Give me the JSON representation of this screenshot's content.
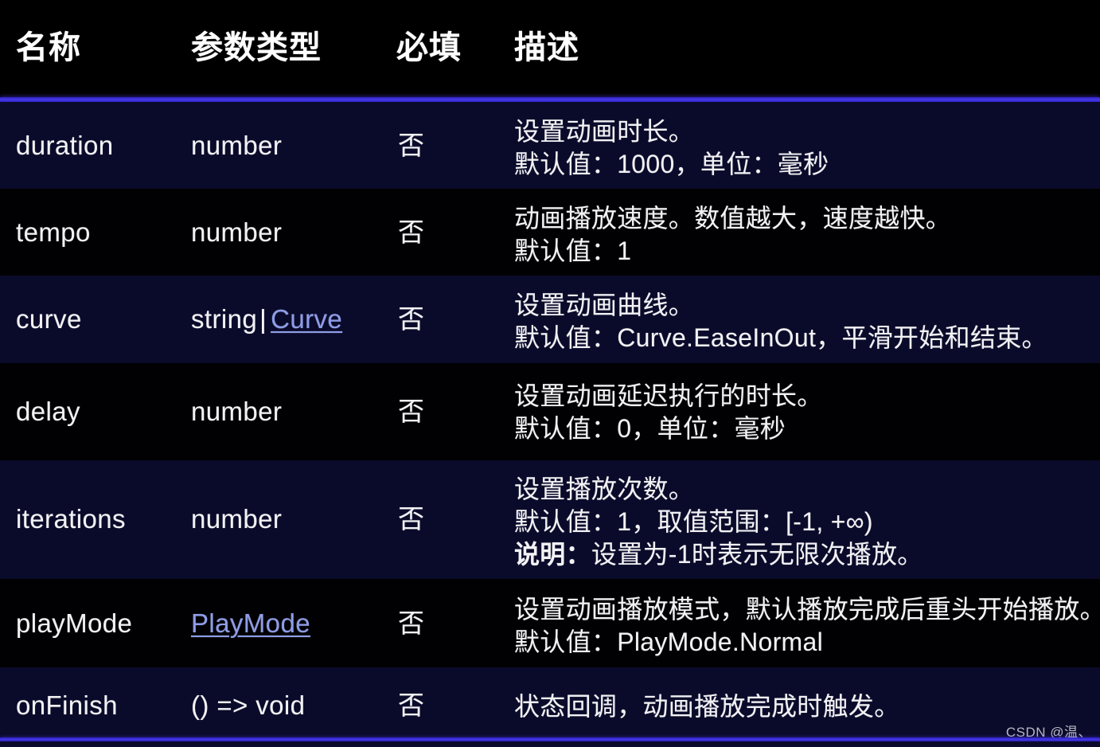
{
  "table": {
    "columns": [
      {
        "key": "name",
        "label": "名称"
      },
      {
        "key": "type",
        "label": "参数类型"
      },
      {
        "key": "required",
        "label": "必填"
      },
      {
        "key": "description",
        "label": "描述"
      }
    ],
    "rows": [
      {
        "name": "duration",
        "type_text": "number",
        "type_link": "",
        "required": "否",
        "desc_lines": [
          "设置动画时长。",
          "默认值：1000，单位：毫秒"
        ]
      },
      {
        "name": "tempo",
        "type_text": "number",
        "type_link": "",
        "required": "否",
        "desc_lines": [
          "动画播放速度。数值越大，速度越快。",
          "默认值：1"
        ]
      },
      {
        "name": "curve",
        "type_text": "string",
        "type_link": "Curve",
        "required": "否",
        "desc_lines": [
          "设置动画曲线。",
          "默认值：Curve.EaseInOut，平滑开始和结束。"
        ]
      },
      {
        "name": "delay",
        "type_text": "number",
        "type_link": "",
        "required": "否",
        "desc_lines": [
          "设置动画延迟执行的时长。",
          "默认值：0，单位：毫秒"
        ]
      },
      {
        "name": "iterations",
        "type_text": "number",
        "type_link": "",
        "required": "否",
        "desc_lines": [
          "设置播放次数。",
          "默认值：1，取值范围：[-1, +∞)",
          "说明：设置为-1时表示无限次播放。"
        ],
        "desc_bold_prefix_line": 2,
        "desc_bold_prefix": "说明："
      },
      {
        "name": "playMode",
        "type_text": "",
        "type_link": "PlayMode",
        "required": "否",
        "desc_lines": [
          "设置动画播放模式，默认播放完成后重头开始播放。",
          "默认值：PlayMode.Normal"
        ]
      },
      {
        "name": "onFinish",
        "type_text": "() => void",
        "type_link": "",
        "required": "否",
        "desc_lines": [
          "状态回调，动画播放完成时触发。"
        ]
      }
    ]
  },
  "watermark": "CSDN @温、",
  "colors": {
    "header_bg": "#000000",
    "row_odd_bg": "#0a0a2a",
    "row_even_bg": "#010104",
    "divider": "#4638e8",
    "link": "#8e9de9",
    "text": "#f2f2f5"
  }
}
